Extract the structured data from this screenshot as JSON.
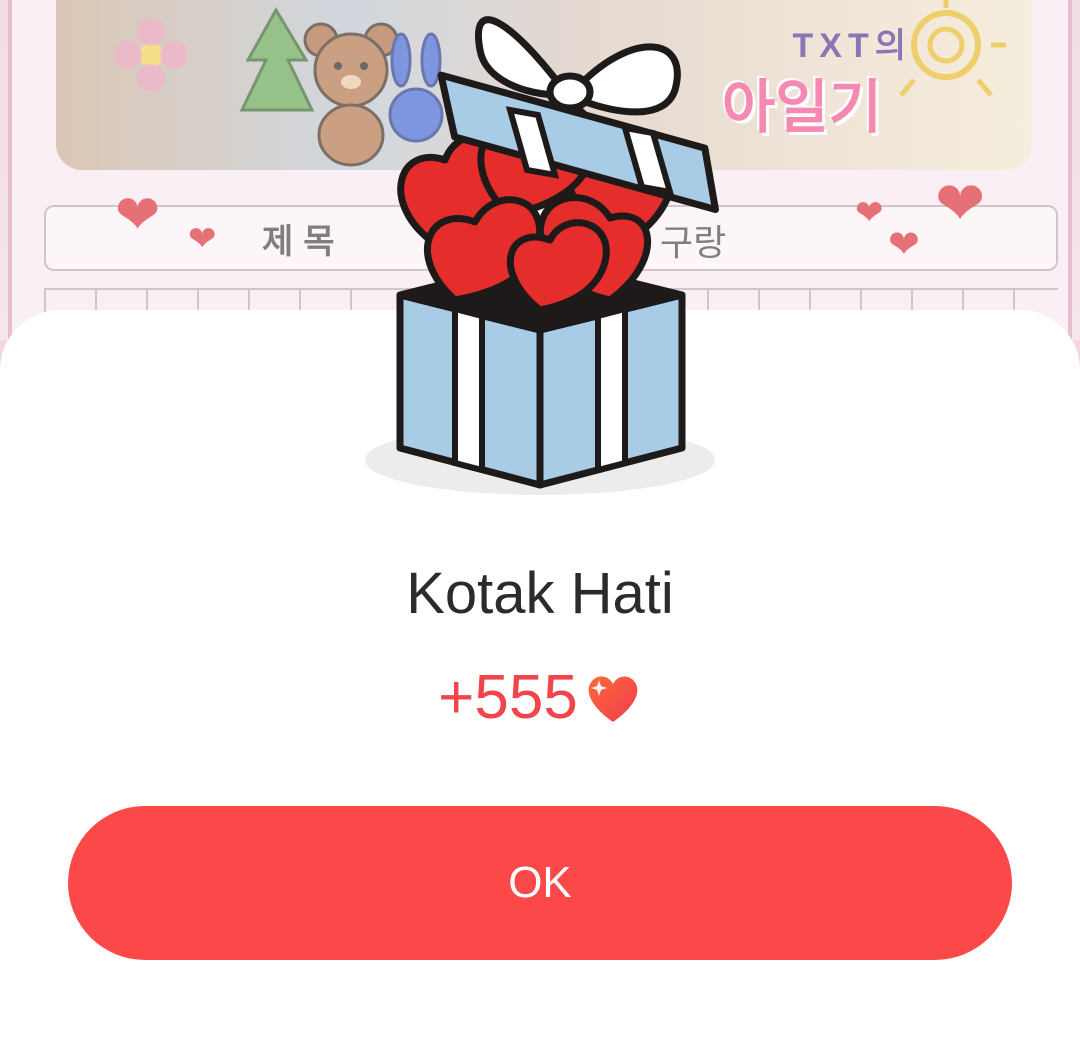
{
  "background": {
    "banner_title_line1": "TXT의",
    "banner_title_line2": "아일기",
    "title_row_label": "제목",
    "title_row_value": "구랑"
  },
  "dialog": {
    "title": "Kotak Hati",
    "reward_amount": "+555",
    "reward_icon": "heart-icon",
    "ok_label": "OK"
  },
  "colors": {
    "accent": "#fb4848",
    "amount_text": "#f0464b",
    "gift_box_blue": "#a8cbe6",
    "heart_red": "#e52e2c"
  }
}
